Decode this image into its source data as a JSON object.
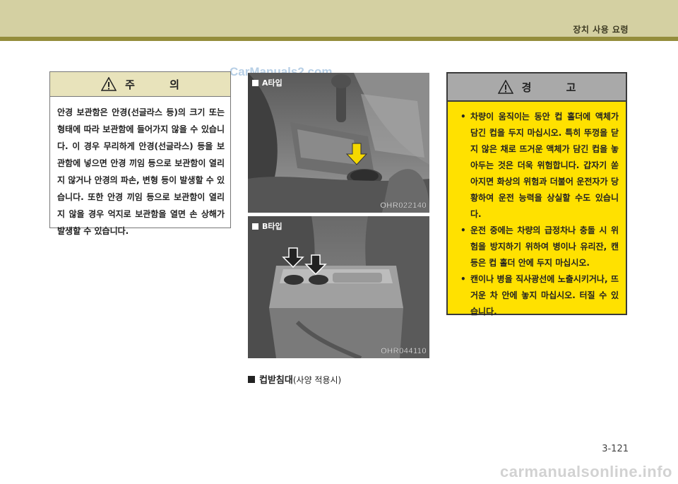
{
  "header": {
    "section_title": "장치 사용 요령"
  },
  "watermark_top": "CarManuals2.com",
  "caution": {
    "title": "주 의",
    "body": "안경 보관함은 안경(선글라스 등)의 크기 또는 형태에 따라 보관함에 들어가지 않을 수 있습니다. 이 경우 무리하게 안경(선글라스) 등을 보관함에 넣으면 안경 끼임 등으로 보관함이 열리지 않거나 안경의 파손, 변형 등이 발생할 수 있습니다. 또한 안경 끼임 등으로 보관함이 열리지 않을 경우 억지로 보관함을 열면 손 상해가 발생할 수 있습니다."
  },
  "photos": [
    {
      "label": "A타입",
      "code": "OHR022140"
    },
    {
      "label": "B타입",
      "code": "OHR044110"
    }
  ],
  "caption": {
    "title": "컵받침대",
    "subtitle": "(사양 적용시)"
  },
  "warning": {
    "title": "경 고",
    "items": [
      "차량이 움직이는 동안 컵 홀더에 액체가 담긴 컵을 두지 마십시오. 특히 뚜껑을 닫지 않은 채로 뜨거운 액체가 담긴 컵을 놓아두는 것은 더욱 위험합니다. 갑자기 쏟아지면 화상의 위험과 더불어 운전자가 당황하여 운전 능력을 상실할 수도 있습니다.",
      "운전 중에는 차량의 급정차나 충돌 시 위험을 방지하기 위하여 병이나 유리잔, 캔 등은 컵 홀더 안에 두지 마십시오.",
      "캔이나 병을 직사광선에 노출시키거나, 뜨거운 차 안에 놓지 마십시오. 터질 수 있습니다."
    ]
  },
  "page_number": "3-121",
  "watermark_bottom": "carmanualsonline.info",
  "colors": {
    "header_band": "#d4d0a2",
    "header_line": "#948d3c",
    "caution_header": "#e8e3bb",
    "warning_bg": "#ffe100",
    "warning_header": "#a9a9a9",
    "arrow": "#f5d800"
  }
}
